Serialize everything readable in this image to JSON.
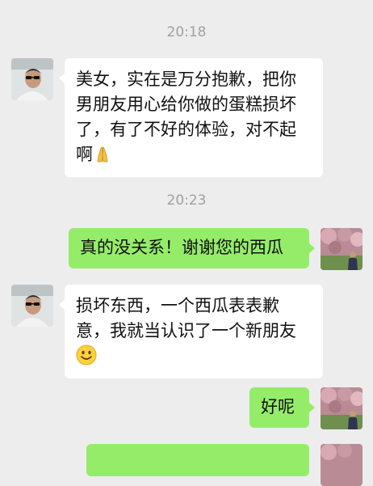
{
  "chat": {
    "time_1": "20:18",
    "time_2": "20:23",
    "messages": [
      {
        "sender": "other",
        "text": "美女，实在是万分抱歉，把你男朋友用心给你做的蛋糕损坏了，有了不好的体验，对不起啊",
        "emoji": "folded-hands-icon"
      },
      {
        "sender": "me",
        "text": "真的没关系！谢谢您的西瓜"
      },
      {
        "sender": "other",
        "text": "损坏东西，一个西瓜表表歉意，我就当认识了一个新朋友",
        "emoji": "smiling-face-icon"
      },
      {
        "sender": "me",
        "text": "好呢"
      },
      {
        "sender": "me",
        "text": ""
      }
    ]
  },
  "colors": {
    "background": "#ededed",
    "incoming_bubble": "#ffffff",
    "outgoing_bubble": "#95ec69",
    "timestamp": "#a0a0a0"
  }
}
